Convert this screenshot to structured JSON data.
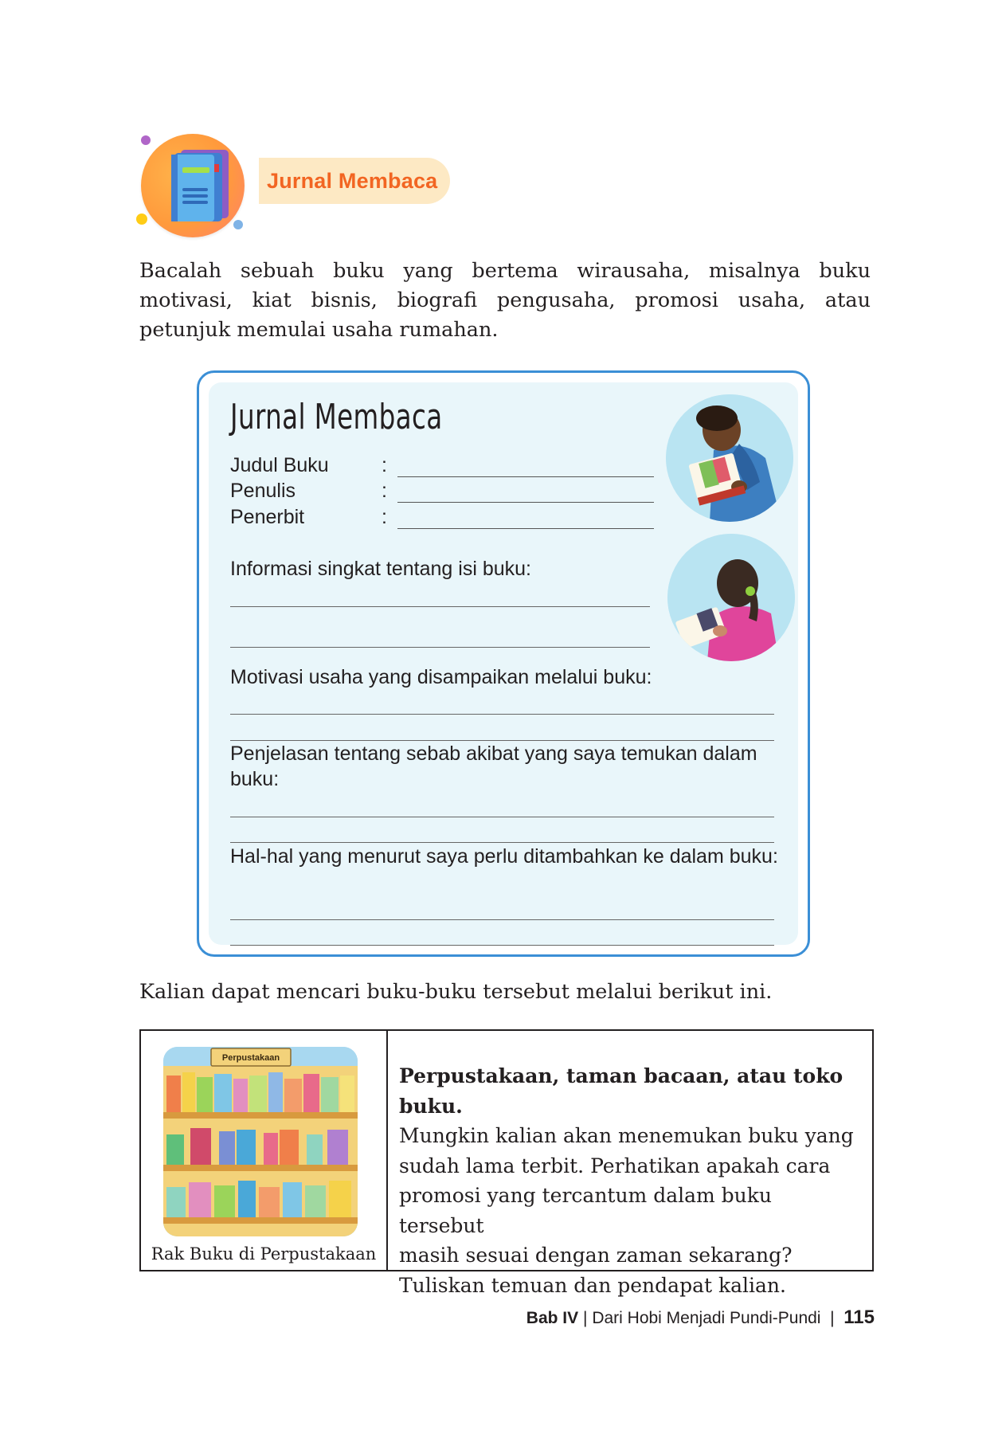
{
  "section": {
    "icon": "book-icon",
    "title": "Jurnal Membaca"
  },
  "intro": "Bacalah sebuah buku yang bertema wirausaha, misalnya buku motivasi, kiat bisnis, biografi pengusaha, promosi usaha, atau petunjuk memulai usaha rumahan.",
  "journal": {
    "title": "Jurnal Membaca",
    "fields": [
      {
        "label": "Judul Buku",
        "colon": ":"
      },
      {
        "label": "Penulis",
        "colon": ":"
      },
      {
        "label": "Penerbit",
        "colon": ":"
      }
    ],
    "prompts": [
      "Informasi singkat tentang isi buku:",
      "Motivasi usaha yang disampaikan melalui buku:",
      "Penjelasan tentang sebab akibat yang saya temukan dalam buku:",
      "Hal-hal yang menurut saya perlu ditambahkan ke dalam buku:"
    ],
    "images": [
      "boy-reading-illustration",
      "girl-reading-illustration"
    ]
  },
  "find_text": "Kalian dapat mencari buku-buku tersebut melalui berikut ini.",
  "table": {
    "image_sign": "Perpustakaan",
    "caption": "Rak Buku di Perpustakaan",
    "desc_bold": "Perpustakaan, taman bacaan, atau toko buku.",
    "desc_lines": [
      "Mungkin kalian akan menemukan buku yang",
      "sudah lama terbit. Perhatikan apakah cara",
      "promosi yang tercantum dalam buku tersebut",
      "masih sesuai dengan zaman sekarang?",
      "Tuliskan temuan dan pendapat kalian."
    ]
  },
  "footer": {
    "chapter": "Bab IV",
    "separator1": "|",
    "title": "Dari Hobi Menjadi Pundi-Pundi",
    "separator2": "|",
    "page": "115"
  },
  "colors": {
    "accent_orange": "#f26522",
    "pill_bg": "#fde9c4",
    "card_border": "#3b8fd6",
    "card_bg": "#e9f6fa"
  }
}
